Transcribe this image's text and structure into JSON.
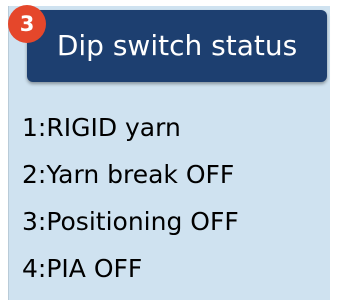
{
  "badge": {
    "number": "3",
    "color": "#e5472b"
  },
  "header": {
    "title": "Dip switch status",
    "background": "#1d3f70"
  },
  "panel": {
    "background": "#cfe2f0"
  },
  "status_items": [
    {
      "label": "1:RIGID yarn"
    },
    {
      "label": "2:Yarn break OFF"
    },
    {
      "label": "3:Positioning OFF"
    },
    {
      "label": "4:PIA OFF"
    }
  ]
}
